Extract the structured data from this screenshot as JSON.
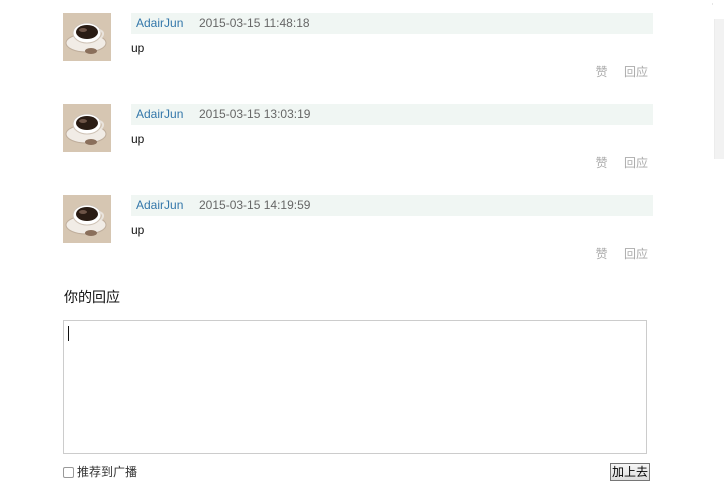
{
  "comments": [
    {
      "author": "AdairJun",
      "time": "2015-03-15 11:48:18",
      "text": "up",
      "like_label": "赞",
      "reply_label": "回应"
    },
    {
      "author": "AdairJun",
      "time": "2015-03-15 13:03:19",
      "text": "up",
      "like_label": "赞",
      "reply_label": "回应"
    },
    {
      "author": "AdairJun",
      "time": "2015-03-15 14:19:59",
      "text": "up",
      "like_label": "赞",
      "reply_label": "回应"
    }
  ],
  "reply_form": {
    "title": "你的回应",
    "value": "",
    "broadcast_label": "推荐到广播",
    "broadcast_checked": false,
    "submit_label": "加上去"
  },
  "colors": {
    "author_link": "#3377aa",
    "meta_background": "#f0f6f3",
    "action_text": "#aaaaaa"
  },
  "icons": {
    "avatar": "coffee-cup-avatar"
  }
}
